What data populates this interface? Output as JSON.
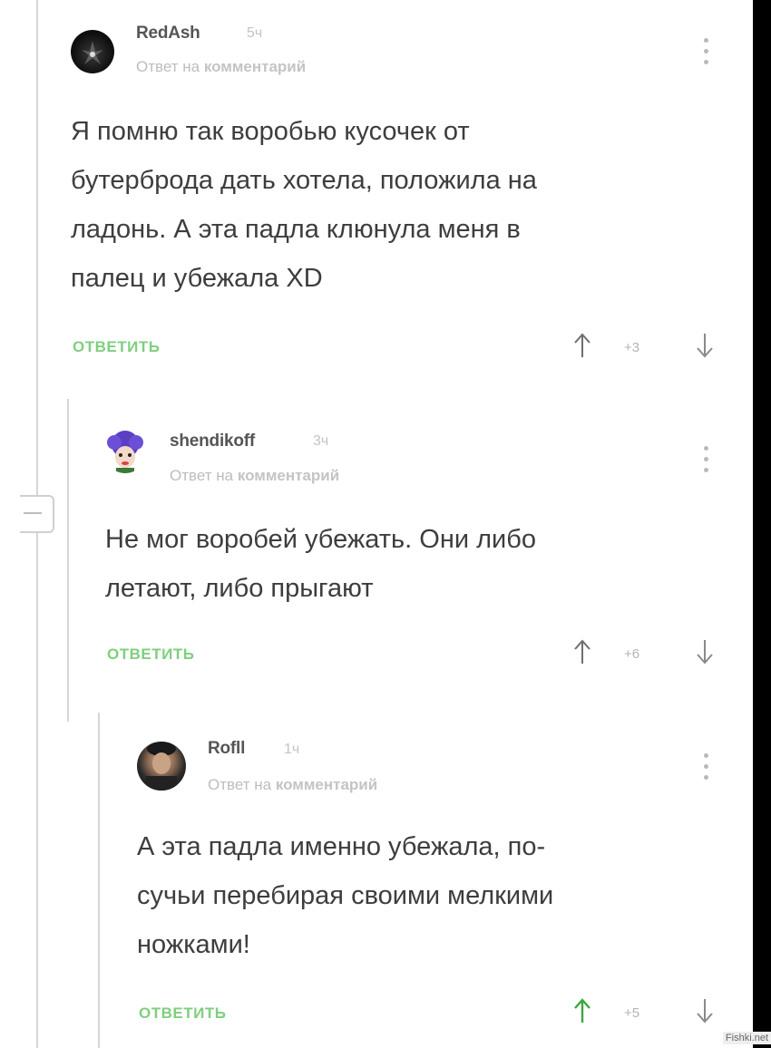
{
  "comments": [
    {
      "username": "RedAsh",
      "time": "5ч",
      "reply_prefix": "Ответ на",
      "reply_target": "комментарий",
      "lines": [
        "Я помню так воробью кусочек от",
        "бутерброда дать хотела, положила на",
        "ладонь. А эта падла клюнула меня в",
        "палец и убежала XD"
      ],
      "reply_label": "ОТВЕТИТЬ",
      "rating": "+3"
    },
    {
      "username": "shendikoff",
      "time": "3ч",
      "reply_prefix": "Ответ на",
      "reply_target": "комментарий",
      "lines": [
        "Не мог воробей убежать. Они либо",
        "летают, либо прыгают"
      ],
      "reply_label": "ОТВЕТИТЬ",
      "rating": "+6"
    },
    {
      "username": "Rofll",
      "time": "1ч",
      "reply_prefix": "Ответ на",
      "reply_target": "комментарий",
      "lines": [
        "А эта падла именно убежала, по-",
        "сучьи перебирая своими мелкими",
        "ножками!"
      ],
      "reply_label": "ОТВЕТИТЬ",
      "rating": "+5"
    }
  ],
  "watermark": "Fishki.net",
  "colors": {
    "accent_green": "#7fcf7f",
    "upvote_active": "#3aa83a",
    "muted": "#bdbdbd"
  }
}
